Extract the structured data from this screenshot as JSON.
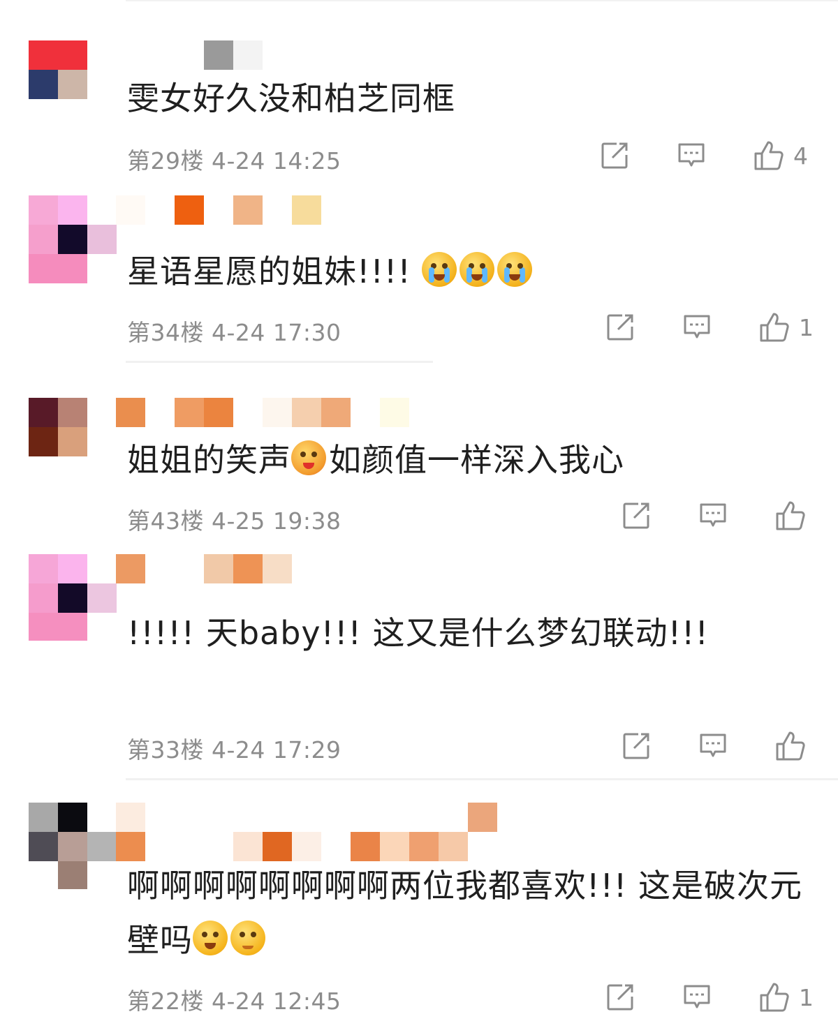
{
  "comments": [
    {
      "text": "雯女好久没和柏芝同框",
      "floor": "第29楼",
      "date": "4-24",
      "time": "14:25",
      "likes": "4",
      "emojis": []
    },
    {
      "text": "星语星愿的姐妹!!!!",
      "floor": "第34楼",
      "date": "4-24",
      "time": "17:30",
      "likes": "1",
      "emojis": [
        "crying-emoji",
        "crying-emoji",
        "crying-emoji"
      ]
    },
    {
      "text_before": "姐姐的笑声",
      "text_after": "如颜值一样深入我心",
      "floor": "第43楼",
      "date": "4-25",
      "time": "19:38",
      "likes": "",
      "emojis": [
        "heart-face-emoji"
      ]
    },
    {
      "text": "!!!!! 天baby!!! 这又是什么梦幻联动!!!",
      "floor": "第33楼",
      "date": "4-24",
      "time": "17:29",
      "likes": "",
      "emojis": []
    },
    {
      "text": "啊啊啊啊啊啊啊啊两位我都喜欢!!! 这是破次元壁吗",
      "floor": "第22楼",
      "date": "4-24",
      "time": "12:45",
      "likes": "1",
      "emojis": [
        "laughing-tears-emoji",
        "smiling-emoji"
      ]
    }
  ],
  "icons": {
    "share": "share-icon",
    "reply": "reply-icon",
    "like": "thumbs-up-icon"
  },
  "colors": {
    "text": "#1f1f1f",
    "meta": "#8c8c8c",
    "icon": "#8c8c8c"
  }
}
